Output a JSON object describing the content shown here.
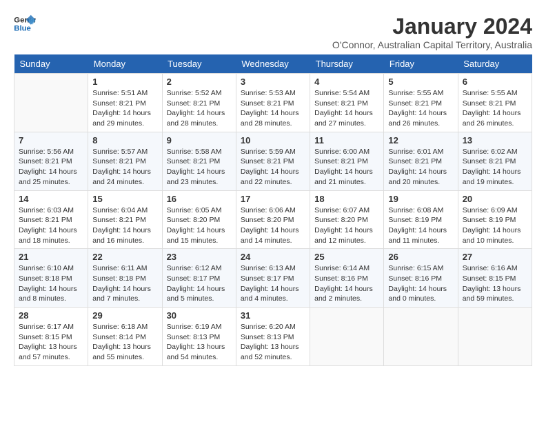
{
  "header": {
    "logo_line1": "General",
    "logo_line2": "Blue",
    "month_year": "January 2024",
    "location": "O'Connor, Australian Capital Territory, Australia"
  },
  "weekdays": [
    "Sunday",
    "Monday",
    "Tuesday",
    "Wednesday",
    "Thursday",
    "Friday",
    "Saturday"
  ],
  "weeks": [
    [
      {
        "day": "",
        "empty": true
      },
      {
        "day": "1",
        "sunrise": "Sunrise: 5:51 AM",
        "sunset": "Sunset: 8:21 PM",
        "daylight": "Daylight: 14 hours and 29 minutes."
      },
      {
        "day": "2",
        "sunrise": "Sunrise: 5:52 AM",
        "sunset": "Sunset: 8:21 PM",
        "daylight": "Daylight: 14 hours and 28 minutes."
      },
      {
        "day": "3",
        "sunrise": "Sunrise: 5:53 AM",
        "sunset": "Sunset: 8:21 PM",
        "daylight": "Daylight: 14 hours and 28 minutes."
      },
      {
        "day": "4",
        "sunrise": "Sunrise: 5:54 AM",
        "sunset": "Sunset: 8:21 PM",
        "daylight": "Daylight: 14 hours and 27 minutes."
      },
      {
        "day": "5",
        "sunrise": "Sunrise: 5:55 AM",
        "sunset": "Sunset: 8:21 PM",
        "daylight": "Daylight: 14 hours and 26 minutes."
      },
      {
        "day": "6",
        "sunrise": "Sunrise: 5:55 AM",
        "sunset": "Sunset: 8:21 PM",
        "daylight": "Daylight: 14 hours and 26 minutes."
      }
    ],
    [
      {
        "day": "7",
        "sunrise": "Sunrise: 5:56 AM",
        "sunset": "Sunset: 8:21 PM",
        "daylight": "Daylight: 14 hours and 25 minutes."
      },
      {
        "day": "8",
        "sunrise": "Sunrise: 5:57 AM",
        "sunset": "Sunset: 8:21 PM",
        "daylight": "Daylight: 14 hours and 24 minutes."
      },
      {
        "day": "9",
        "sunrise": "Sunrise: 5:58 AM",
        "sunset": "Sunset: 8:21 PM",
        "daylight": "Daylight: 14 hours and 23 minutes."
      },
      {
        "day": "10",
        "sunrise": "Sunrise: 5:59 AM",
        "sunset": "Sunset: 8:21 PM",
        "daylight": "Daylight: 14 hours and 22 minutes."
      },
      {
        "day": "11",
        "sunrise": "Sunrise: 6:00 AM",
        "sunset": "Sunset: 8:21 PM",
        "daylight": "Daylight: 14 hours and 21 minutes."
      },
      {
        "day": "12",
        "sunrise": "Sunrise: 6:01 AM",
        "sunset": "Sunset: 8:21 PM",
        "daylight": "Daylight: 14 hours and 20 minutes."
      },
      {
        "day": "13",
        "sunrise": "Sunrise: 6:02 AM",
        "sunset": "Sunset: 8:21 PM",
        "daylight": "Daylight: 14 hours and 19 minutes."
      }
    ],
    [
      {
        "day": "14",
        "sunrise": "Sunrise: 6:03 AM",
        "sunset": "Sunset: 8:21 PM",
        "daylight": "Daylight: 14 hours and 18 minutes."
      },
      {
        "day": "15",
        "sunrise": "Sunrise: 6:04 AM",
        "sunset": "Sunset: 8:21 PM",
        "daylight": "Daylight: 14 hours and 16 minutes."
      },
      {
        "day": "16",
        "sunrise": "Sunrise: 6:05 AM",
        "sunset": "Sunset: 8:20 PM",
        "daylight": "Daylight: 14 hours and 15 minutes."
      },
      {
        "day": "17",
        "sunrise": "Sunrise: 6:06 AM",
        "sunset": "Sunset: 8:20 PM",
        "daylight": "Daylight: 14 hours and 14 minutes."
      },
      {
        "day": "18",
        "sunrise": "Sunrise: 6:07 AM",
        "sunset": "Sunset: 8:20 PM",
        "daylight": "Daylight: 14 hours and 12 minutes."
      },
      {
        "day": "19",
        "sunrise": "Sunrise: 6:08 AM",
        "sunset": "Sunset: 8:19 PM",
        "daylight": "Daylight: 14 hours and 11 minutes."
      },
      {
        "day": "20",
        "sunrise": "Sunrise: 6:09 AM",
        "sunset": "Sunset: 8:19 PM",
        "daylight": "Daylight: 14 hours and 10 minutes."
      }
    ],
    [
      {
        "day": "21",
        "sunrise": "Sunrise: 6:10 AM",
        "sunset": "Sunset: 8:18 PM",
        "daylight": "Daylight: 14 hours and 8 minutes."
      },
      {
        "day": "22",
        "sunrise": "Sunrise: 6:11 AM",
        "sunset": "Sunset: 8:18 PM",
        "daylight": "Daylight: 14 hours and 7 minutes."
      },
      {
        "day": "23",
        "sunrise": "Sunrise: 6:12 AM",
        "sunset": "Sunset: 8:17 PM",
        "daylight": "Daylight: 14 hours and 5 minutes."
      },
      {
        "day": "24",
        "sunrise": "Sunrise: 6:13 AM",
        "sunset": "Sunset: 8:17 PM",
        "daylight": "Daylight: 14 hours and 4 minutes."
      },
      {
        "day": "25",
        "sunrise": "Sunrise: 6:14 AM",
        "sunset": "Sunset: 8:16 PM",
        "daylight": "Daylight: 14 hours and 2 minutes."
      },
      {
        "day": "26",
        "sunrise": "Sunrise: 6:15 AM",
        "sunset": "Sunset: 8:16 PM",
        "daylight": "Daylight: 14 hours and 0 minutes."
      },
      {
        "day": "27",
        "sunrise": "Sunrise: 6:16 AM",
        "sunset": "Sunset: 8:15 PM",
        "daylight": "Daylight: 13 hours and 59 minutes."
      }
    ],
    [
      {
        "day": "28",
        "sunrise": "Sunrise: 6:17 AM",
        "sunset": "Sunset: 8:15 PM",
        "daylight": "Daylight: 13 hours and 57 minutes."
      },
      {
        "day": "29",
        "sunrise": "Sunrise: 6:18 AM",
        "sunset": "Sunset: 8:14 PM",
        "daylight": "Daylight: 13 hours and 55 minutes."
      },
      {
        "day": "30",
        "sunrise": "Sunrise: 6:19 AM",
        "sunset": "Sunset: 8:13 PM",
        "daylight": "Daylight: 13 hours and 54 minutes."
      },
      {
        "day": "31",
        "sunrise": "Sunrise: 6:20 AM",
        "sunset": "Sunset: 8:13 PM",
        "daylight": "Daylight: 13 hours and 52 minutes."
      },
      {
        "day": "",
        "empty": true
      },
      {
        "day": "",
        "empty": true
      },
      {
        "day": "",
        "empty": true
      }
    ]
  ]
}
